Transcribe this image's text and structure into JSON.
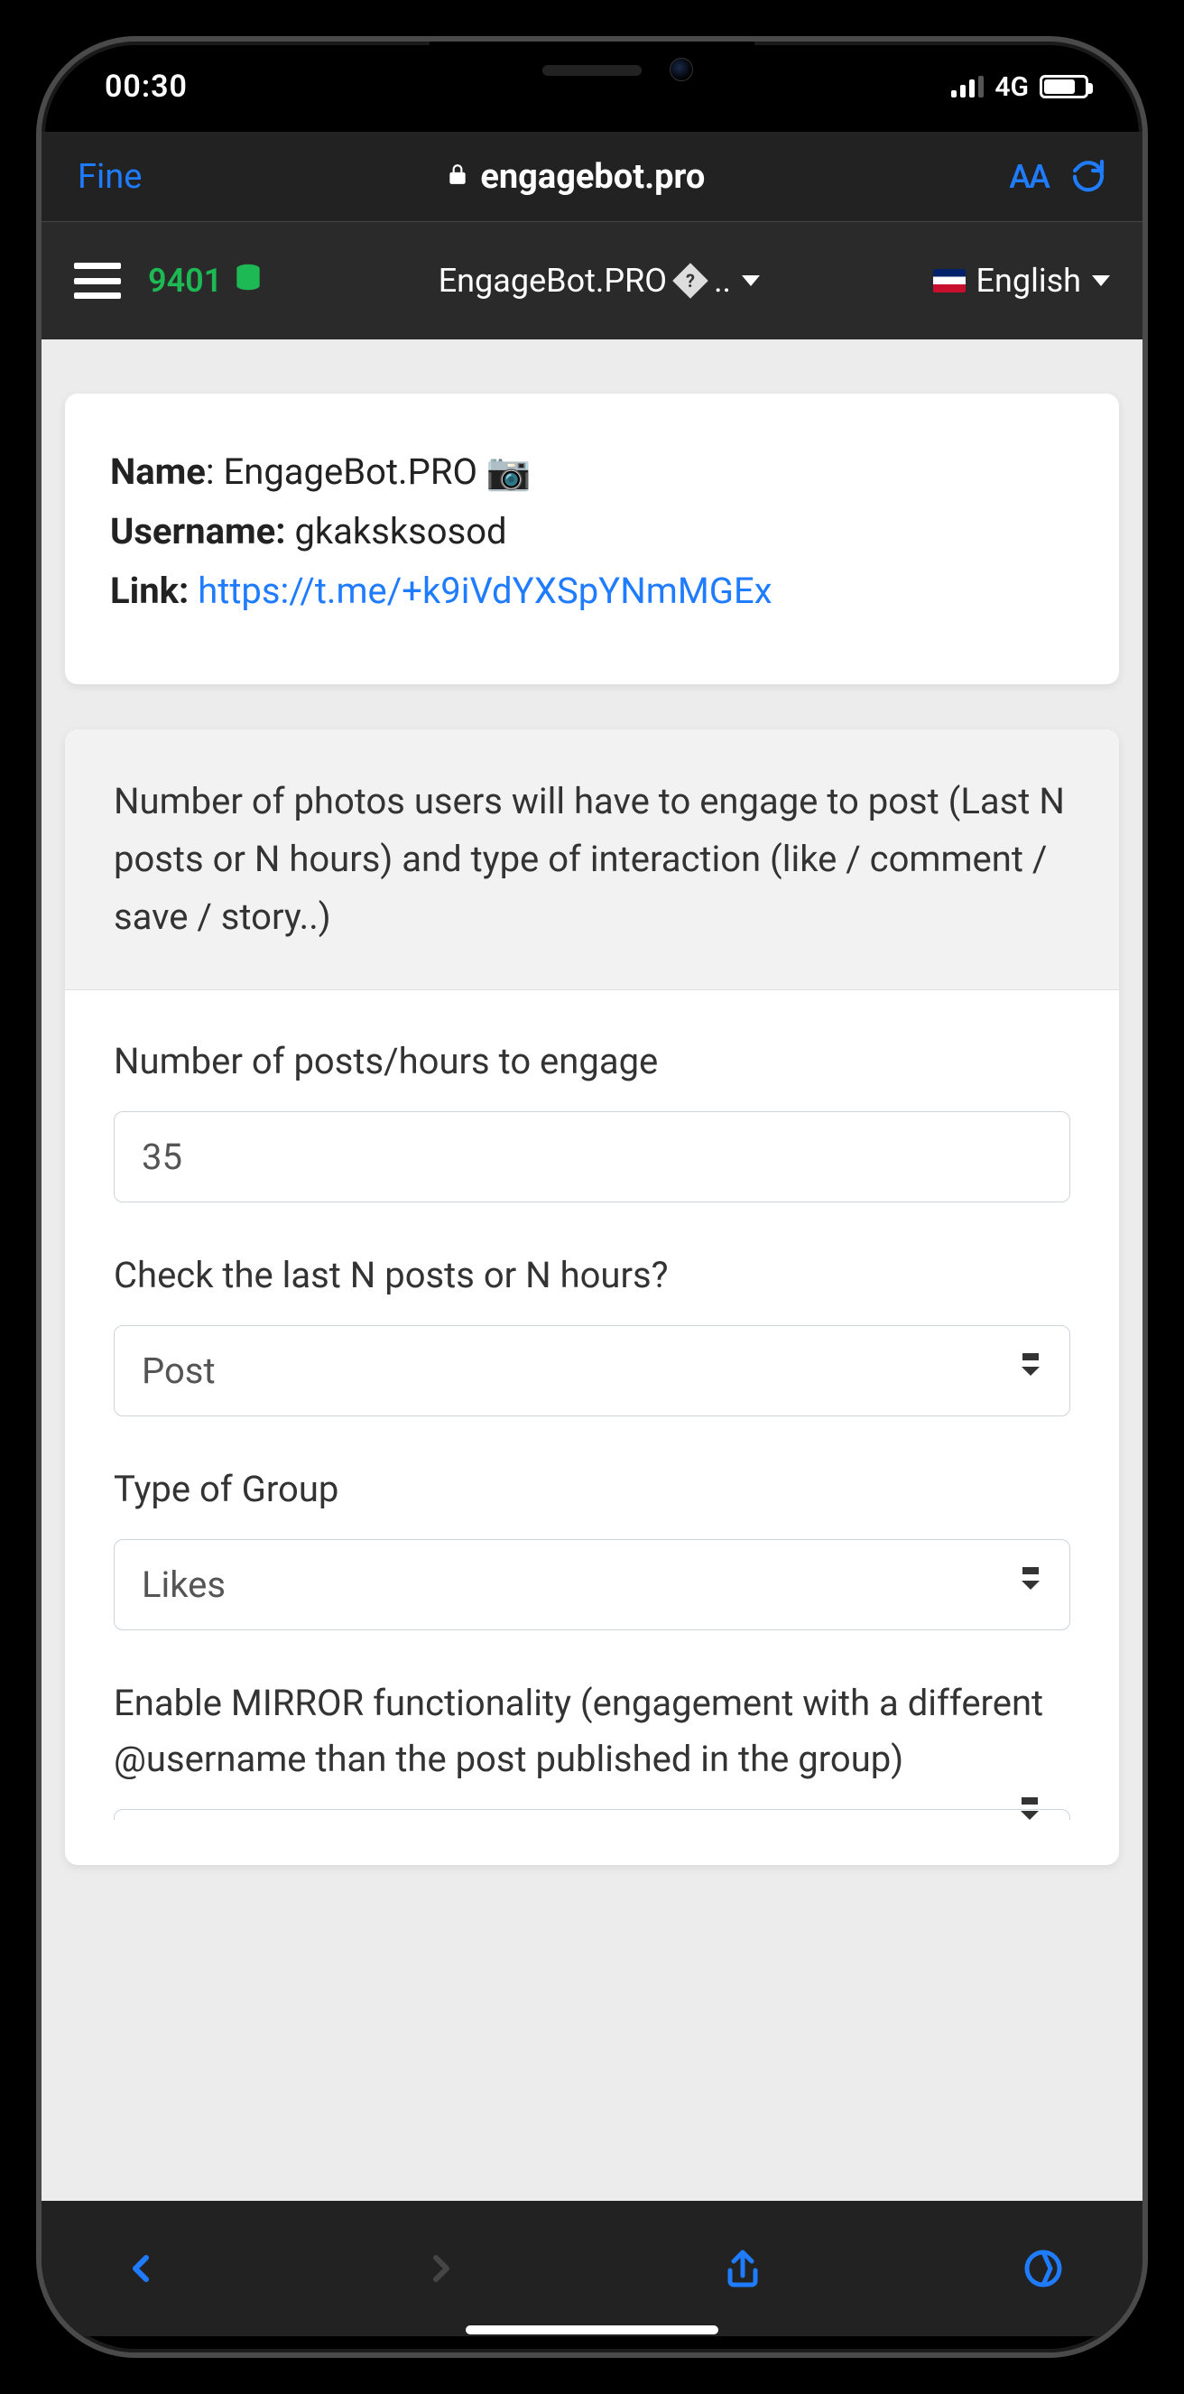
{
  "status": {
    "time": "00:30",
    "network": "4G"
  },
  "browser": {
    "back_label": "Fine",
    "domain": "engagebot.pro",
    "reader": "AA"
  },
  "appbar": {
    "credits": "9401",
    "bot_name": "EngageBot.PRO",
    "bot_extra": "..",
    "language": "English"
  },
  "info": {
    "name_label": "Name",
    "name_value": "EngageBot.PRO 📷",
    "username_label": "Username:",
    "username_value": "gkaksksosod",
    "link_label": "Link:",
    "link_url": "https://t.me/+k9iVdYXSpYNmMGEx"
  },
  "section": {
    "header": "Number of photos users will have to engage to post (Last N posts or N hours) and type of interaction (like / comment / save / story..)",
    "fields": {
      "posts_label": "Number of posts/hours to engage",
      "posts_value": "35",
      "check_label": "Check the last N posts or N hours?",
      "check_value": "Post",
      "type_label": "Type of Group",
      "type_value": "Likes",
      "mirror_label": "Enable MIRROR functionality (engagement with a different @username than the post published in the group)"
    }
  }
}
